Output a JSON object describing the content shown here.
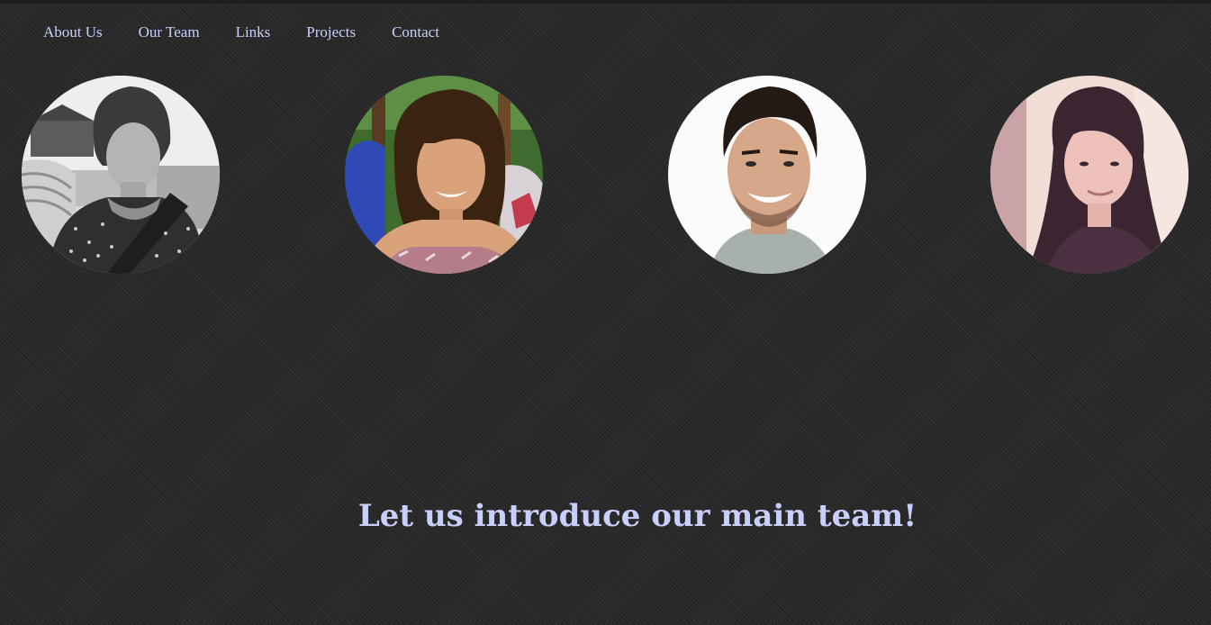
{
  "nav": {
    "items": [
      {
        "label": "About Us"
      },
      {
        "label": "Our Team"
      },
      {
        "label": "Links"
      },
      {
        "label": "Projects"
      },
      {
        "label": "Contact"
      }
    ]
  },
  "team": {
    "members": [
      {
        "photo": "grayscale portrait of woman with curly hair"
      },
      {
        "photo": "portrait of smiling woman outdoors"
      },
      {
        "photo": "portrait of smiling man on white background"
      },
      {
        "photo": "portrait of woman with pink tint"
      }
    ]
  },
  "headline": "Let us introduce our main team!",
  "colors": {
    "background": "#2a2a2a",
    "link": "#c9cffc",
    "headline": "#c9cffc"
  }
}
